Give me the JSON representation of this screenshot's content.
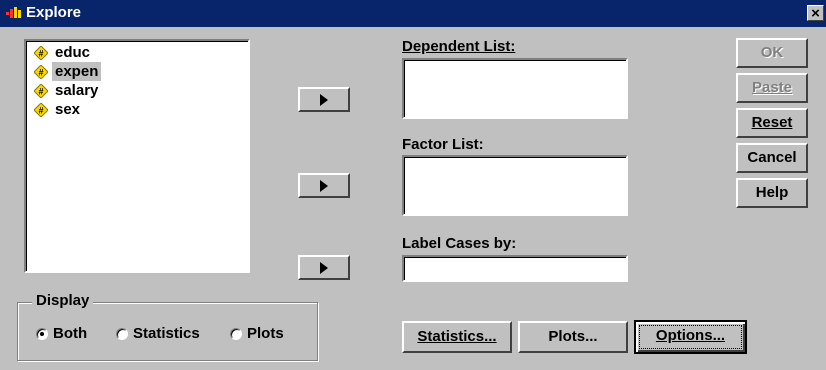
{
  "window": {
    "title": "Explore",
    "close_glyph": "×"
  },
  "variables": [
    {
      "name": "educ",
      "icon": "scale-variable-icon",
      "selected": false
    },
    {
      "name": "expen",
      "icon": "scale-variable-icon",
      "selected": true
    },
    {
      "name": "salary",
      "icon": "scale-variable-icon",
      "selected": false
    },
    {
      "name": "sex",
      "icon": "scale-variable-icon",
      "selected": false
    }
  ],
  "dependent_list": {
    "label": "Dependent List:",
    "items": []
  },
  "factor_list": {
    "label": "Factor List:",
    "items": []
  },
  "label_cases": {
    "label": "Label Cases by:",
    "value": ""
  },
  "buttons": {
    "ok": "OK",
    "paste": "Paste",
    "reset": "Reset",
    "cancel": "Cancel",
    "help": "Help",
    "statistics": "Statistics...",
    "plots": "Plots...",
    "options": "Options..."
  },
  "display": {
    "title": "Display",
    "options": [
      "Both",
      "Statistics",
      "Plots"
    ],
    "selected": "Both"
  },
  "colors": {
    "title_bar": "#08246b",
    "face": "#c0c0c0",
    "icon_yellow": "#ffd700"
  }
}
